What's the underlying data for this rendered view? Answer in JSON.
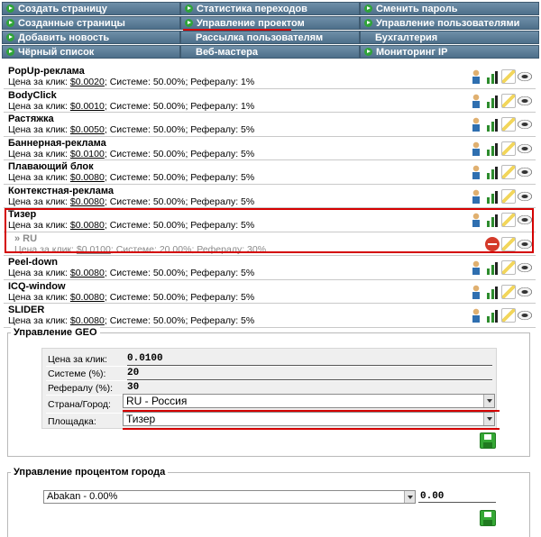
{
  "nav": {
    "col1": [
      "Создать страницу",
      "Созданные страницы",
      "Добавить новость",
      "Чёрный список"
    ],
    "col2": [
      "Статистика переходов",
      "Управление проектом",
      "Рассылка пользователям",
      "Веб-мастера"
    ],
    "col3": [
      "Сменить пароль",
      "Управление пользователями",
      "Бухгалтерия",
      "Мониторинг IP"
    ]
  },
  "labels": {
    "price": "Цена за клик:",
    "system": "Системе:",
    "referral": "Рефералу:"
  },
  "ads": [
    {
      "name": "PopUp-реклама",
      "price": "$0.0020",
      "system": "50.00%;",
      "referral": "1%"
    },
    {
      "name": "BodyClick",
      "price": "$0.0010",
      "system": "50.00%;",
      "referral": "1%"
    },
    {
      "name": "Растяжка",
      "price": "$0.0050",
      "system": "50.00%;",
      "referral": "5%"
    },
    {
      "name": "Баннерная-реклама",
      "price": "$0.0100",
      "system": "50.00%;",
      "referral": "5%"
    },
    {
      "name": "Плавающий блок",
      "price": "$0.0080",
      "system": "50.00%;",
      "referral": "5%"
    },
    {
      "name": "Контекстная-реклама",
      "price": "$0.0080",
      "system": "50.00%;",
      "referral": "5%"
    },
    {
      "name": "Тизер",
      "price": "$0.0080",
      "system": "50.00%;",
      "referral": "5%"
    },
    {
      "name": "» RU",
      "price": "$0.0100",
      "system": "20.00%;",
      "referral": "30%",
      "sub": true
    },
    {
      "name": "Peel-down",
      "price": "$0.0080",
      "system": "50.00%;",
      "referral": "5%"
    },
    {
      "name": "ICQ-window",
      "price": "$0.0080",
      "system": "50.00%;",
      "referral": "5%"
    },
    {
      "name": "SLIDER",
      "price": "$0.0080",
      "system": "50.00%;",
      "referral": "5%"
    }
  ],
  "geo": {
    "legend": "Управление GEO",
    "price_label": "Цена за клик:",
    "price_value": "0.0100",
    "system_label": "Системе (%):",
    "system_value": "20",
    "referral_label": "Рефералу (%):",
    "referral_value": "30",
    "country_label": "Страна/Город:",
    "country_value": "RU - Россия",
    "placement_label": "Площадка:",
    "placement_value": "Тизер"
  },
  "city": {
    "legend": "Управление процентом города",
    "select_value": "Abakan - 0.00%",
    "percent_value": "0.00"
  },
  "colors": {
    "nav_bg": "#5a7b96",
    "highlight": "#d40000",
    "save": "#35a835"
  }
}
